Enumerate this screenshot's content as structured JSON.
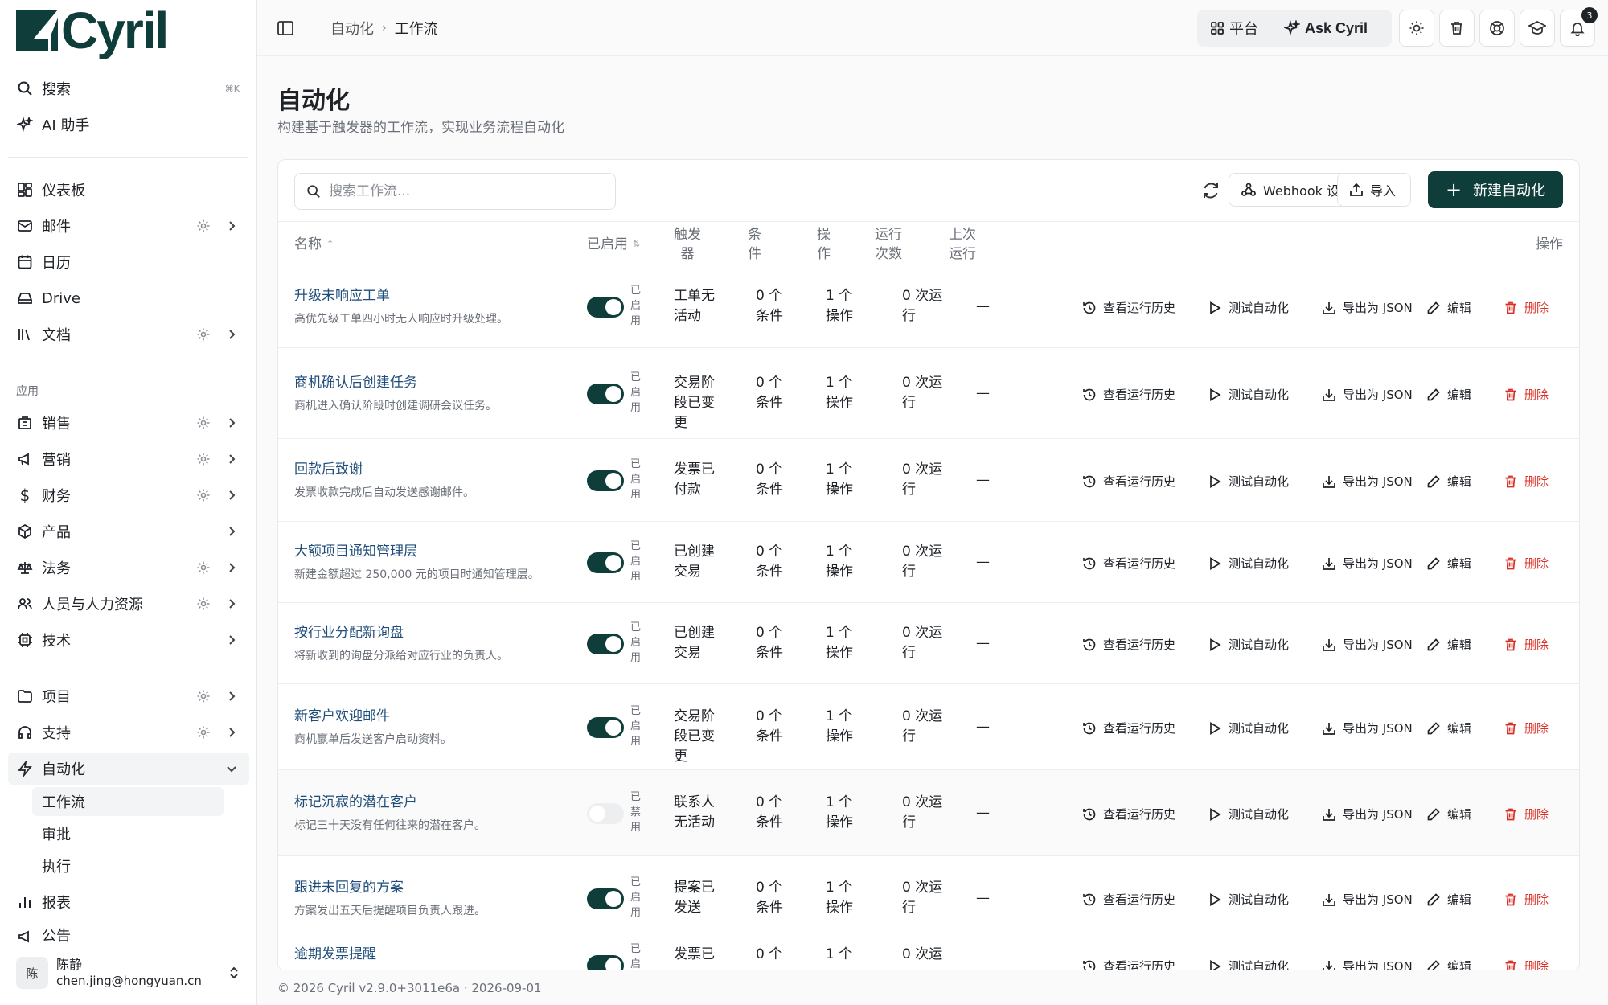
{
  "brand": {
    "name": "Cyril"
  },
  "sidebar": {
    "search": {
      "label": "搜索",
      "shortcut": "⌘K"
    },
    "ai": {
      "label": "AI 助手"
    },
    "items": [
      {
        "label": "仪表板"
      },
      {
        "label": "邮件"
      },
      {
        "label": "日历"
      },
      {
        "label": "Drive"
      },
      {
        "label": "文档"
      }
    ],
    "apps_section": "应用",
    "apps": [
      {
        "label": "销售"
      },
      {
        "label": "营销"
      },
      {
        "label": "财务"
      },
      {
        "label": "产品"
      },
      {
        "label": "法务"
      },
      {
        "label": "人员与人力资源"
      },
      {
        "label": "技术"
      }
    ],
    "more": [
      {
        "label": "项目"
      },
      {
        "label": "支持"
      },
      {
        "label": "自动化"
      }
    ],
    "automation_sub": [
      {
        "label": "工作流"
      },
      {
        "label": "审批"
      },
      {
        "label": "执行"
      }
    ],
    "bottom": [
      {
        "label": "报表"
      },
      {
        "label": "公告"
      }
    ],
    "user": {
      "avatar": "陈",
      "name": "陈静",
      "email": "chen.jing@hongyuan.cn"
    }
  },
  "topbar": {
    "breadcrumb": [
      "自动化",
      "工作流"
    ],
    "platform_label": "平台",
    "ask_label": "Ask Cyril",
    "notification_count": "3"
  },
  "page": {
    "title": "自动化",
    "subtitle": "构建基于触发器的工作流，实现业务流程自动化"
  },
  "toolbar": {
    "search_placeholder": "搜索工作流...",
    "webhook_label": "Webhook 设置",
    "import_label": "导入",
    "new_label": "新建自动化"
  },
  "table": {
    "columns": {
      "name": "名称",
      "enabled": "已启用",
      "trigger": "触发器",
      "conditions": "条件",
      "actions": "操作",
      "runs": "运行次数",
      "last_run": "上次运行",
      "ops": "操作"
    },
    "action_labels": {
      "history": "查看运行历史",
      "test": "测试自动化",
      "export": "导出为 JSON",
      "edit": "编辑",
      "delete": "删除"
    },
    "rows": [
      {
        "name": "升级未响应工单",
        "desc": "高优先级工单四小时无人响应时升级处理。",
        "enabled": true,
        "status": "已启用",
        "trigger": "工单无活动",
        "conditions": "0 个条件",
        "actions": "1 个操作",
        "runs": "0 次运行",
        "last_run": "—"
      },
      {
        "name": "商机确认后创建任务",
        "desc": "商机进入确认阶段时创建调研会议任务。",
        "enabled": true,
        "status": "已启用",
        "trigger": "交易阶段已变更",
        "conditions": "0 个条件",
        "actions": "1 个操作",
        "runs": "0 次运行",
        "last_run": "—"
      },
      {
        "name": "回款后致谢",
        "desc": "发票收款完成后自动发送感谢邮件。",
        "enabled": true,
        "status": "已启用",
        "trigger": "发票已付款",
        "conditions": "0 个条件",
        "actions": "1 个操作",
        "runs": "0 次运行",
        "last_run": "—"
      },
      {
        "name": "大额项目通知管理层",
        "desc": "新建金额超过 250,000 元的项目时通知管理层。",
        "enabled": true,
        "status": "已启用",
        "trigger": "已创建交易",
        "conditions": "0 个条件",
        "actions": "1 个操作",
        "runs": "0 次运行",
        "last_run": "—"
      },
      {
        "name": "按行业分配新询盘",
        "desc": "将新收到的询盘分派给对应行业的负责人。",
        "enabled": true,
        "status": "已启用",
        "trigger": "已创建交易",
        "conditions": "0 个条件",
        "actions": "1 个操作",
        "runs": "0 次运行",
        "last_run": "—"
      },
      {
        "name": "新客户欢迎邮件",
        "desc": "商机赢单后发送客户启动资料。",
        "enabled": true,
        "status": "已启用",
        "trigger": "交易阶段已变更",
        "conditions": "0 个条件",
        "actions": "1 个操作",
        "runs": "0 次运行",
        "last_run": "—"
      },
      {
        "name": "标记沉寂的潜在客户",
        "desc": "标记三十天没有任何往来的潜在客户。",
        "enabled": false,
        "status": "已禁用",
        "trigger": "联系人无活动",
        "conditions": "0 个条件",
        "actions": "1 个操作",
        "runs": "0 次运行",
        "last_run": "—"
      },
      {
        "name": "跟进未回复的方案",
        "desc": "方案发出五天后提醒项目负责人跟进。",
        "enabled": true,
        "status": "已启用",
        "trigger": "提案已发送",
        "conditions": "0 个条件",
        "actions": "1 个操作",
        "runs": "0 次运行",
        "last_run": "—"
      },
      {
        "name": "逾期发票提醒",
        "desc": "",
        "enabled": true,
        "status": "已启用",
        "trigger": "发票已",
        "conditions": "0 个",
        "actions": "1 个",
        "runs": "0 次运",
        "last_run": ""
      }
    ]
  },
  "footer": {
    "text": "© 2026 Cyril v2.9.0+3011e6a · 2026-09-01"
  },
  "colors": {
    "brand": "#0e3d3a",
    "link": "#1f4d7a",
    "danger": "#d93025"
  }
}
